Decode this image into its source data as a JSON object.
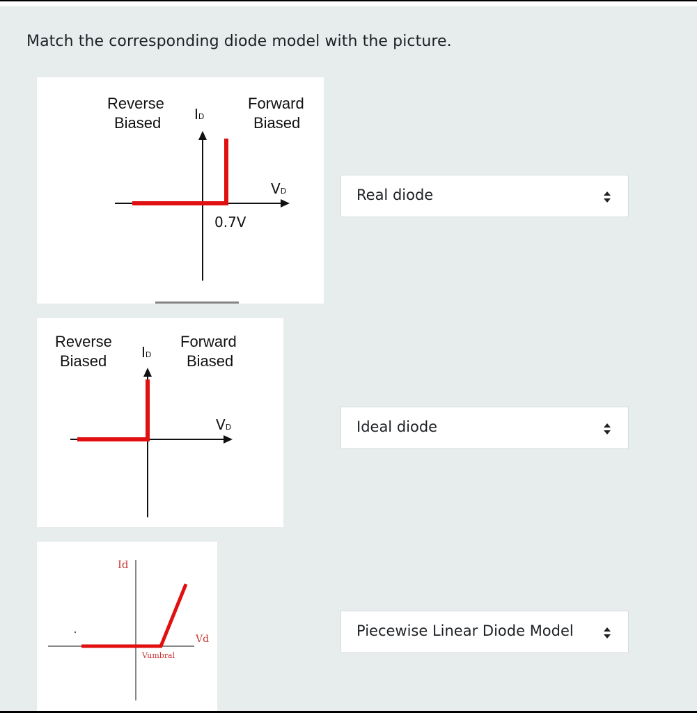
{
  "question": "Match the corresponding diode model with the picture.",
  "colors": {
    "curve": "#e01010",
    "panel": "#e7eded",
    "axis": "#111111"
  },
  "rows": [
    {
      "graph": {
        "reverse_line1": "Reverse",
        "reverse_line2": "Biased",
        "forward_line1": "Forward",
        "forward_line2": "Biased",
        "current_label": "I",
        "current_sub": "D",
        "voltage_label": "V",
        "voltage_sub": "D",
        "knee_label": "0.7V"
      },
      "answer": "Real diode"
    },
    {
      "graph": {
        "reverse_line1": "Reverse",
        "reverse_line2": "Biased",
        "forward_line1": "Forward",
        "forward_line2": "Biased",
        "current_label": "I",
        "current_sub": "D",
        "voltage_label": "V",
        "voltage_sub": "D"
      },
      "answer": "Ideal diode"
    },
    {
      "graph": {
        "current_label": "Id",
        "voltage_label": "Vd",
        "knee_label": "Vumbral"
      },
      "answer": "Piecewise Linear Diode Model"
    }
  ]
}
